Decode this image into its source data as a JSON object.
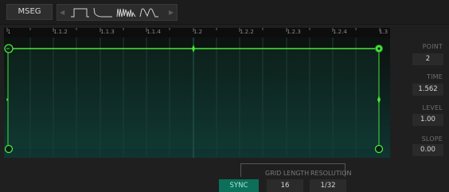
{
  "toolbar": {
    "title": "MSEG",
    "shapes": [
      "square-shape-icon",
      "decay-shape-icon",
      "noise-shape-icon",
      "pulse-shape-icon"
    ]
  },
  "ruler": {
    "labels": [
      "1",
      "1.1.2",
      "1.1.3",
      "1.1.4",
      "1.2",
      "1.2.2",
      "1.2.3",
      "1.2.4",
      "1.3"
    ]
  },
  "panel": {
    "point_label": "POINT",
    "point_value": "2",
    "time_label": "TIME",
    "time_value": "1.562",
    "level_label": "LEVEL",
    "level_value": "1.00",
    "slope_label": "SLOPE",
    "slope_value": "0.00"
  },
  "bottom": {
    "sync_label": "SYNC",
    "grid_length_label": "GRID LENGTH",
    "grid_length_value": "16",
    "resolution_label": "RESOLUTION",
    "resolution_value": "1/32"
  },
  "colors": {
    "envelope": "#46e83a",
    "sync_active": "#0d6e5a"
  }
}
